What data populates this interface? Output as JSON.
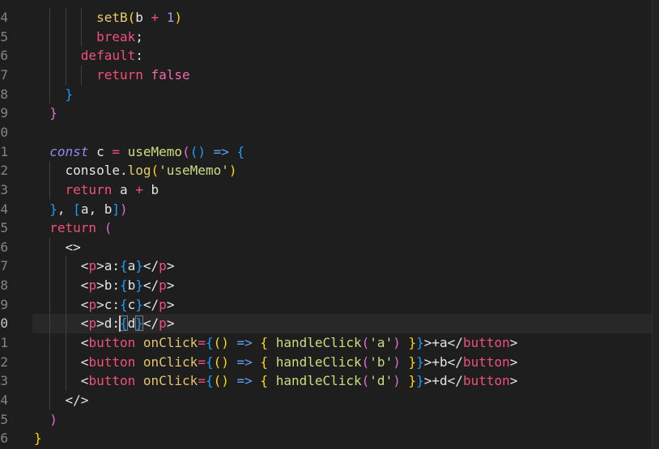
{
  "colors": {
    "background": "#1e1e1e",
    "plain": "#e4e4e4",
    "ws": "#e4e4e4",
    "kw": "#f2507b",
    "op": "#f2507b",
    "bool": "#ef6aa8",
    "storage": "#8c8cf4",
    "fn": "#e6cc6a",
    "fn2": "#cfdc7c",
    "str": "#c8dd84",
    "attr": "#e8c36b",
    "arrow": "#5ea3f5",
    "num": "#b48ef5",
    "gold": "#ffd700",
    "orchid": "#da70d6",
    "blue": "#179fff"
  },
  "current_line": 16,
  "cursor": {
    "line": 16,
    "col": 11
  },
  "lines": [
    {
      "num": "4",
      "tokens": [
        {
          "t": "        ",
          "k": "ws"
        },
        {
          "t": "setB",
          "k": "fn"
        },
        {
          "t": "(",
          "k": "gold"
        },
        {
          "t": "b ",
          "k": "plain"
        },
        {
          "t": "+",
          "k": "op"
        },
        {
          "t": " ",
          "k": "plain"
        },
        {
          "t": "1",
          "k": "num"
        },
        {
          "t": ")",
          "k": "gold"
        }
      ]
    },
    {
      "num": "5",
      "tokens": [
        {
          "t": "        ",
          "k": "ws"
        },
        {
          "t": "break",
          "k": "kw"
        },
        {
          "t": ";",
          "k": "plain"
        }
      ]
    },
    {
      "num": "6",
      "tokens": [
        {
          "t": "      ",
          "k": "ws"
        },
        {
          "t": "default",
          "k": "kw"
        },
        {
          "t": ":",
          "k": "plain"
        }
      ]
    },
    {
      "num": "7",
      "tokens": [
        {
          "t": "        ",
          "k": "ws"
        },
        {
          "t": "return",
          "k": "kw"
        },
        {
          "t": " ",
          "k": "plain"
        },
        {
          "t": "false",
          "k": "bool"
        }
      ]
    },
    {
      "num": "8",
      "tokens": [
        {
          "t": "    ",
          "k": "ws"
        },
        {
          "t": "}",
          "k": "blue"
        }
      ]
    },
    {
      "num": "9",
      "tokens": [
        {
          "t": "  ",
          "k": "ws"
        },
        {
          "t": "}",
          "k": "orchid"
        }
      ]
    },
    {
      "num": "0",
      "tokens": []
    },
    {
      "num": "1",
      "tokens": [
        {
          "t": "  ",
          "k": "ws"
        },
        {
          "t": "const",
          "k": "storage"
        },
        {
          "t": " c ",
          "k": "plain"
        },
        {
          "t": "=",
          "k": "op"
        },
        {
          "t": " ",
          "k": "plain"
        },
        {
          "t": "useMemo",
          "k": "fn2"
        },
        {
          "t": "(",
          "k": "orchid"
        },
        {
          "t": "()",
          "k": "blue"
        },
        {
          "t": " ",
          "k": "plain"
        },
        {
          "t": "=>",
          "k": "arrow"
        },
        {
          "t": " ",
          "k": "plain"
        },
        {
          "t": "{",
          "k": "blue"
        }
      ]
    },
    {
      "num": "2",
      "tokens": [
        {
          "t": "    ",
          "k": "ws"
        },
        {
          "t": "console.",
          "k": "plain"
        },
        {
          "t": "log",
          "k": "fn"
        },
        {
          "t": "(",
          "k": "gold"
        },
        {
          "t": "'useMemo'",
          "k": "str"
        },
        {
          "t": ")",
          "k": "gold"
        }
      ]
    },
    {
      "num": "3",
      "tokens": [
        {
          "t": "    ",
          "k": "ws"
        },
        {
          "t": "return",
          "k": "kw"
        },
        {
          "t": " a ",
          "k": "plain"
        },
        {
          "t": "+",
          "k": "op"
        },
        {
          "t": " b",
          "k": "plain"
        }
      ]
    },
    {
      "num": "4",
      "tokens": [
        {
          "t": "  ",
          "k": "ws"
        },
        {
          "t": "}",
          "k": "blue"
        },
        {
          "t": ", ",
          "k": "plain"
        },
        {
          "t": "[",
          "k": "blue"
        },
        {
          "t": "a, b",
          "k": "plain"
        },
        {
          "t": "]",
          "k": "blue"
        },
        {
          "t": ")",
          "k": "orchid"
        }
      ]
    },
    {
      "num": "5",
      "tokens": [
        {
          "t": "  ",
          "k": "ws"
        },
        {
          "t": "return",
          "k": "kw"
        },
        {
          "t": " ",
          "k": "plain"
        },
        {
          "t": "(",
          "k": "orchid"
        }
      ]
    },
    {
      "num": "6",
      "tokens": [
        {
          "t": "    ",
          "k": "ws"
        },
        {
          "t": "<>",
          "k": "plain"
        }
      ]
    },
    {
      "num": "7",
      "tokens": [
        {
          "t": "      ",
          "k": "ws"
        },
        {
          "t": "<",
          "k": "plain"
        },
        {
          "t": "p",
          "k": "kw"
        },
        {
          "t": ">a:",
          "k": "plain"
        },
        {
          "t": "{",
          "k": "blue"
        },
        {
          "t": "a",
          "k": "plain"
        },
        {
          "t": "}",
          "k": "blue"
        },
        {
          "t": "</",
          "k": "plain"
        },
        {
          "t": "p",
          "k": "kw"
        },
        {
          "t": ">",
          "k": "plain"
        }
      ]
    },
    {
      "num": "8",
      "tokens": [
        {
          "t": "      ",
          "k": "ws"
        },
        {
          "t": "<",
          "k": "plain"
        },
        {
          "t": "p",
          "k": "kw"
        },
        {
          "t": ">b:",
          "k": "plain"
        },
        {
          "t": "{",
          "k": "blue"
        },
        {
          "t": "b",
          "k": "plain"
        },
        {
          "t": "}",
          "k": "blue"
        },
        {
          "t": "</",
          "k": "plain"
        },
        {
          "t": "p",
          "k": "kw"
        },
        {
          "t": ">",
          "k": "plain"
        }
      ]
    },
    {
      "num": "9",
      "tokens": [
        {
          "t": "      ",
          "k": "ws"
        },
        {
          "t": "<",
          "k": "plain"
        },
        {
          "t": "p",
          "k": "kw"
        },
        {
          "t": ">c:",
          "k": "plain"
        },
        {
          "t": "{",
          "k": "blue"
        },
        {
          "t": "c",
          "k": "plain"
        },
        {
          "t": "}",
          "k": "blue"
        },
        {
          "t": "</",
          "k": "plain"
        },
        {
          "t": "p",
          "k": "kw"
        },
        {
          "t": ">",
          "k": "plain"
        }
      ]
    },
    {
      "num": "0",
      "tokens": [
        {
          "t": "      ",
          "k": "ws"
        },
        {
          "t": "<",
          "k": "plain"
        },
        {
          "t": "p",
          "k": "kw"
        },
        {
          "t": ">d:",
          "k": "plain"
        },
        {
          "t": "{",
          "k": "blue",
          "m": true
        },
        {
          "t": "d",
          "k": "plain"
        },
        {
          "t": "}",
          "k": "blue",
          "m": true
        },
        {
          "t": "</",
          "k": "plain"
        },
        {
          "t": "p",
          "k": "kw"
        },
        {
          "t": ">",
          "k": "plain"
        }
      ]
    },
    {
      "num": "1",
      "tokens": [
        {
          "t": "      ",
          "k": "ws"
        },
        {
          "t": "<",
          "k": "plain"
        },
        {
          "t": "button",
          "k": "kw"
        },
        {
          "t": " ",
          "k": "plain"
        },
        {
          "t": "onClick",
          "k": "attr"
        },
        {
          "t": "=",
          "k": "op"
        },
        {
          "t": "{",
          "k": "blue"
        },
        {
          "t": "()",
          "k": "gold"
        },
        {
          "t": " ",
          "k": "plain"
        },
        {
          "t": "=>",
          "k": "arrow"
        },
        {
          "t": " ",
          "k": "plain"
        },
        {
          "t": "{",
          "k": "gold"
        },
        {
          "t": " ",
          "k": "plain"
        },
        {
          "t": "handleClick",
          "k": "fn2"
        },
        {
          "t": "(",
          "k": "orchid"
        },
        {
          "t": "'a'",
          "k": "str"
        },
        {
          "t": ")",
          "k": "orchid"
        },
        {
          "t": " ",
          "k": "plain"
        },
        {
          "t": "}",
          "k": "gold"
        },
        {
          "t": "}",
          "k": "blue"
        },
        {
          "t": ">+a</",
          "k": "plain"
        },
        {
          "t": "button",
          "k": "kw"
        },
        {
          "t": ">",
          "k": "plain"
        }
      ]
    },
    {
      "num": "2",
      "tokens": [
        {
          "t": "      ",
          "k": "ws"
        },
        {
          "t": "<",
          "k": "plain"
        },
        {
          "t": "button",
          "k": "kw"
        },
        {
          "t": " ",
          "k": "plain"
        },
        {
          "t": "onClick",
          "k": "attr"
        },
        {
          "t": "=",
          "k": "op"
        },
        {
          "t": "{",
          "k": "blue"
        },
        {
          "t": "()",
          "k": "gold"
        },
        {
          "t": " ",
          "k": "plain"
        },
        {
          "t": "=>",
          "k": "arrow"
        },
        {
          "t": " ",
          "k": "plain"
        },
        {
          "t": "{",
          "k": "gold"
        },
        {
          "t": " ",
          "k": "plain"
        },
        {
          "t": "handleClick",
          "k": "fn2"
        },
        {
          "t": "(",
          "k": "orchid"
        },
        {
          "t": "'b'",
          "k": "str"
        },
        {
          "t": ")",
          "k": "orchid"
        },
        {
          "t": " ",
          "k": "plain"
        },
        {
          "t": "}",
          "k": "gold"
        },
        {
          "t": "}",
          "k": "blue"
        },
        {
          "t": ">+b</",
          "k": "plain"
        },
        {
          "t": "button",
          "k": "kw"
        },
        {
          "t": ">",
          "k": "plain"
        }
      ]
    },
    {
      "num": "3",
      "tokens": [
        {
          "t": "      ",
          "k": "ws"
        },
        {
          "t": "<",
          "k": "plain"
        },
        {
          "t": "button",
          "k": "kw"
        },
        {
          "t": " ",
          "k": "plain"
        },
        {
          "t": "onClick",
          "k": "attr"
        },
        {
          "t": "=",
          "k": "op"
        },
        {
          "t": "{",
          "k": "blue"
        },
        {
          "t": "()",
          "k": "gold"
        },
        {
          "t": " ",
          "k": "plain"
        },
        {
          "t": "=>",
          "k": "arrow"
        },
        {
          "t": " ",
          "k": "plain"
        },
        {
          "t": "{",
          "k": "gold"
        },
        {
          "t": " ",
          "k": "plain"
        },
        {
          "t": "handleClick",
          "k": "fn2"
        },
        {
          "t": "(",
          "k": "orchid"
        },
        {
          "t": "'d'",
          "k": "str"
        },
        {
          "t": ")",
          "k": "orchid"
        },
        {
          "t": " ",
          "k": "plain"
        },
        {
          "t": "}",
          "k": "gold"
        },
        {
          "t": "}",
          "k": "blue"
        },
        {
          "t": ">+d</",
          "k": "plain"
        },
        {
          "t": "button",
          "k": "kw"
        },
        {
          "t": ">",
          "k": "plain"
        }
      ]
    },
    {
      "num": "4",
      "tokens": [
        {
          "t": "    ",
          "k": "ws"
        },
        {
          "t": "</>",
          "k": "plain"
        }
      ]
    },
    {
      "num": "5",
      "tokens": [
        {
          "t": "  ",
          "k": "ws"
        },
        {
          "t": ")",
          "k": "orchid"
        }
      ]
    },
    {
      "num": "6",
      "tokens": [
        {
          "t": "}",
          "k": "gold"
        }
      ]
    }
  ]
}
